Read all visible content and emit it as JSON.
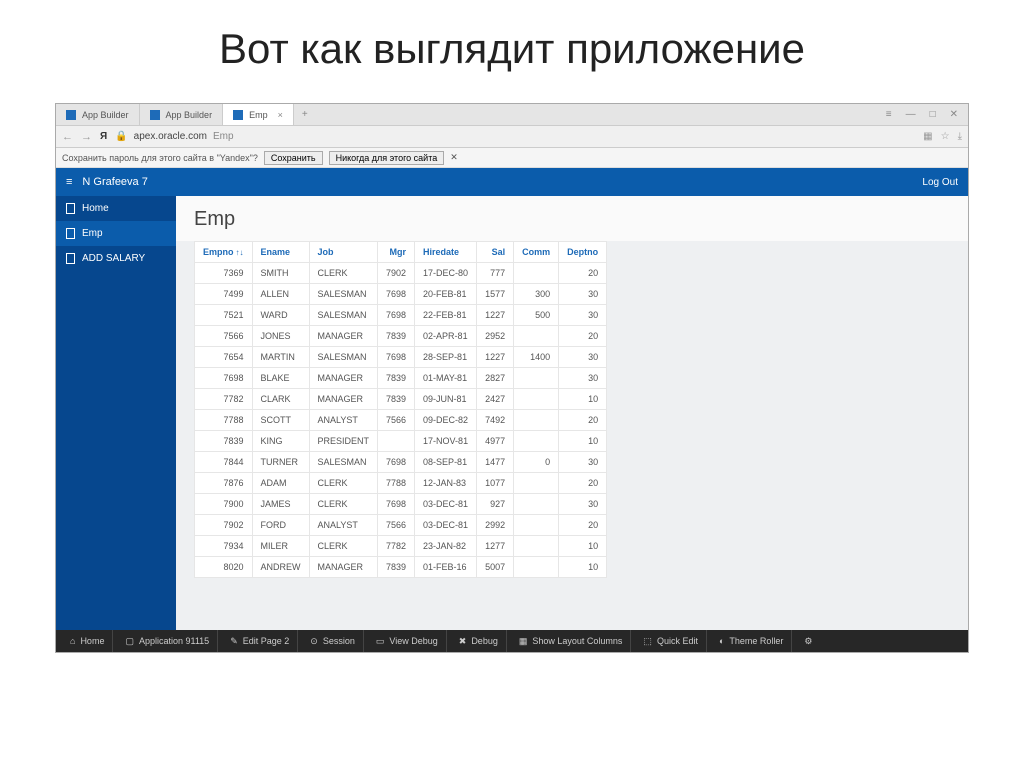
{
  "slide_title": "Вот как выглядит приложение",
  "tabs": [
    {
      "label": "App Builder",
      "active": false
    },
    {
      "label": "App Builder",
      "active": false
    },
    {
      "label": "Emp",
      "active": true
    }
  ],
  "win_controls": {
    "menu": "≡",
    "min": "—",
    "max": "□",
    "close": "✕"
  },
  "nav": {
    "back": "←",
    "fwd": "→",
    "yandex": "Я",
    "host": "apex.oracle.com",
    "path": "Emp",
    "icons": {
      "shield": "▦",
      "star": "☆",
      "dl": "⤓"
    }
  },
  "pwprompt": {
    "text": "Сохранить пароль для этого сайта в \"Yandex\"?",
    "save": "Сохранить",
    "never": "Никогда для этого сайта",
    "close": "✕"
  },
  "app": {
    "title": "N Grafeeva 7",
    "logout": "Log Out",
    "sidebar": [
      {
        "label": "Home"
      },
      {
        "label": "Emp",
        "active": true
      },
      {
        "label": "ADD SALARY"
      }
    ],
    "page_title": "Emp",
    "columns": [
      "Empno",
      "Ename",
      "Job",
      "Mgr",
      "Hiredate",
      "Sal",
      "Comm",
      "Deptno"
    ],
    "sort_indicator": "↑↓",
    "rows": [
      {
        "empno": "7369",
        "ename": "SMITH",
        "job": "CLERK",
        "mgr": "7902",
        "hiredate": "17-DEC-80",
        "sal": "777",
        "comm": "",
        "deptno": "20"
      },
      {
        "empno": "7499",
        "ename": "ALLEN",
        "job": "SALESMAN",
        "mgr": "7698",
        "hiredate": "20-FEB-81",
        "sal": "1577",
        "comm": "300",
        "deptno": "30"
      },
      {
        "empno": "7521",
        "ename": "WARD",
        "job": "SALESMAN",
        "mgr": "7698",
        "hiredate": "22-FEB-81",
        "sal": "1227",
        "comm": "500",
        "deptno": "30"
      },
      {
        "empno": "7566",
        "ename": "JONES",
        "job": "MANAGER",
        "mgr": "7839",
        "hiredate": "02-APR-81",
        "sal": "2952",
        "comm": "",
        "deptno": "20"
      },
      {
        "empno": "7654",
        "ename": "MARTIN",
        "job": "SALESMAN",
        "mgr": "7698",
        "hiredate": "28-SEP-81",
        "sal": "1227",
        "comm": "1400",
        "deptno": "30"
      },
      {
        "empno": "7698",
        "ename": "BLAKE",
        "job": "MANAGER",
        "mgr": "7839",
        "hiredate": "01-MAY-81",
        "sal": "2827",
        "comm": "",
        "deptno": "30"
      },
      {
        "empno": "7782",
        "ename": "CLARK",
        "job": "MANAGER",
        "mgr": "7839",
        "hiredate": "09-JUN-81",
        "sal": "2427",
        "comm": "",
        "deptno": "10"
      },
      {
        "empno": "7788",
        "ename": "SCOTT",
        "job": "ANALYST",
        "mgr": "7566",
        "hiredate": "09-DEC-82",
        "sal": "7492",
        "comm": "",
        "deptno": "20"
      },
      {
        "empno": "7839",
        "ename": "KING",
        "job": "PRESIDENT",
        "mgr": "",
        "hiredate": "17-NOV-81",
        "sal": "4977",
        "comm": "",
        "deptno": "10"
      },
      {
        "empno": "7844",
        "ename": "TURNER",
        "job": "SALESMAN",
        "mgr": "7698",
        "hiredate": "08-SEP-81",
        "sal": "1477",
        "comm": "0",
        "deptno": "30"
      },
      {
        "empno": "7876",
        "ename": "ADAM",
        "job": "CLERK",
        "mgr": "7788",
        "hiredate": "12-JAN-83",
        "sal": "1077",
        "comm": "",
        "deptno": "20"
      },
      {
        "empno": "7900",
        "ename": "JAMES",
        "job": "CLERK",
        "mgr": "7698",
        "hiredate": "03-DEC-81",
        "sal": "927",
        "comm": "",
        "deptno": "30"
      },
      {
        "empno": "7902",
        "ename": "FORD",
        "job": "ANALYST",
        "mgr": "7566",
        "hiredate": "03-DEC-81",
        "sal": "2992",
        "comm": "",
        "deptno": "20"
      },
      {
        "empno": "7934",
        "ename": "MILER",
        "job": "CLERK",
        "mgr": "7782",
        "hiredate": "23-JAN-82",
        "sal": "1277",
        "comm": "",
        "deptno": "10"
      },
      {
        "empno": "8020",
        "ename": "ANDREW",
        "job": "MANAGER",
        "mgr": "7839",
        "hiredate": "01-FEB-16",
        "sal": "5007",
        "comm": "",
        "deptno": "10"
      }
    ]
  },
  "devbar": [
    {
      "label": "Home",
      "icon": "home"
    },
    {
      "label": "Application 91115",
      "icon": "app"
    },
    {
      "label": "Edit Page 2",
      "icon": "edit"
    },
    {
      "label": "Session",
      "icon": "session"
    },
    {
      "label": "View Debug",
      "icon": "view"
    },
    {
      "label": "Debug",
      "icon": "debug"
    },
    {
      "label": "Show Layout Columns",
      "icon": "layout"
    },
    {
      "label": "Quick Edit",
      "icon": "quick"
    },
    {
      "label": "Theme Roller",
      "icon": "theme"
    },
    {
      "label": "",
      "icon": "gear"
    }
  ]
}
